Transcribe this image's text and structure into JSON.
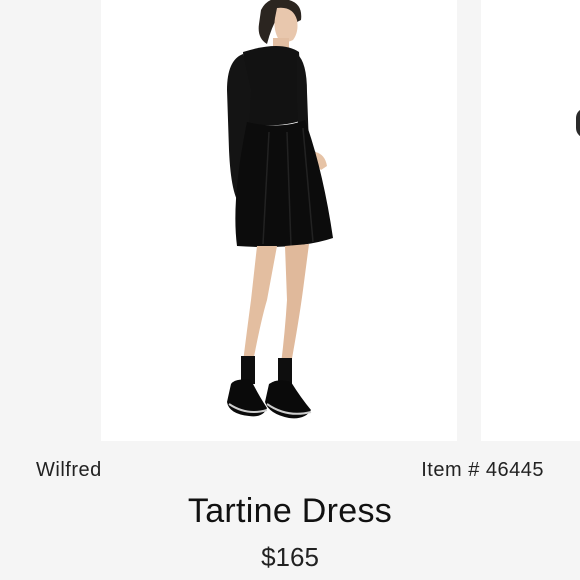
{
  "listing": {
    "brand": "Wilfred",
    "item_number": "Item # 46445",
    "title": "Tartine Dress",
    "price": "$165"
  },
  "gallery": {
    "main_image": "model-wearing-black-dress-photo",
    "next_image": "next-product-photo-partial"
  },
  "colors": {
    "background": "#f5f5f5",
    "card": "#ffffff",
    "text": "#222222"
  }
}
